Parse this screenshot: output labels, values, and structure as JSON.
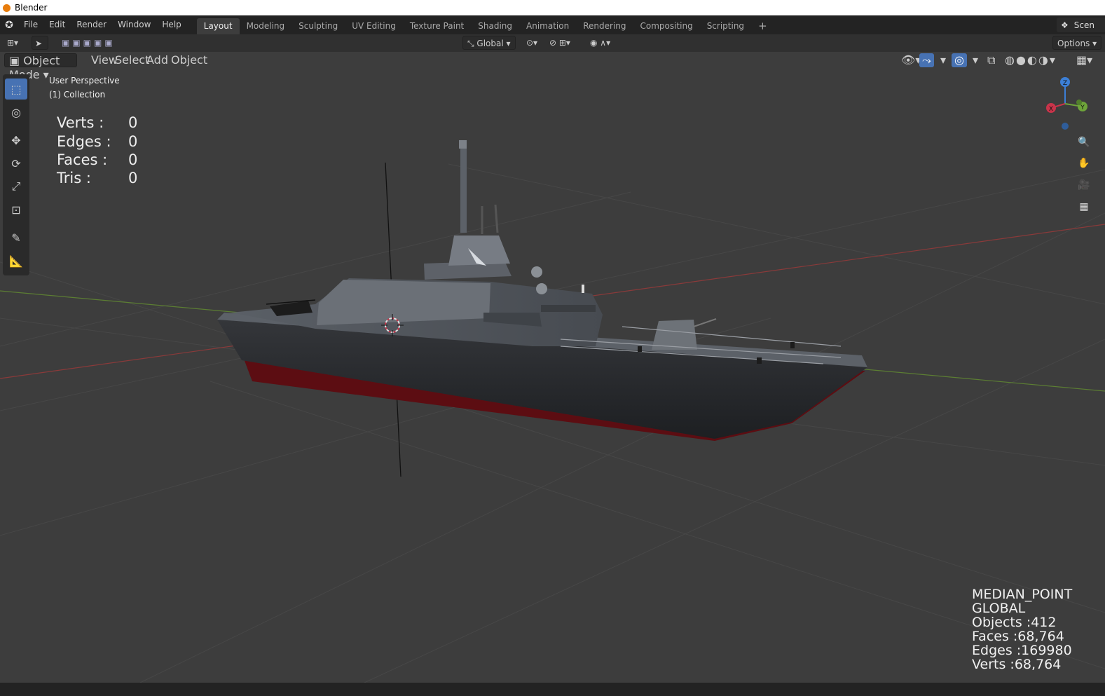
{
  "window": {
    "title": "Blender"
  },
  "menu": [
    "File",
    "Edit",
    "Render",
    "Window",
    "Help"
  ],
  "workspaces": [
    "Layout",
    "Modeling",
    "Sculpting",
    "UV Editing",
    "Texture Paint",
    "Shading",
    "Animation",
    "Rendering",
    "Compositing",
    "Scripting"
  ],
  "header": {
    "scene_label": "Scen",
    "orientation": "Global",
    "options_label": "Options"
  },
  "view_header": {
    "mode": "Object Mode",
    "view": "View",
    "select": "Select",
    "add": "Add",
    "object": "Object"
  },
  "overlay": {
    "perspective": "User Perspective",
    "collection": "(1) Collection"
  },
  "stats_left": [
    {
      "label": "Verts :",
      "value": "0"
    },
    {
      "label": "Edges :",
      "value": "0"
    },
    {
      "label": "Faces :",
      "value": "0"
    },
    {
      "label": "Tris :",
      "value": "0"
    }
  ],
  "stats_right": {
    "pivot": "MEDIAN_POINT",
    "orientation": "GLOBAL",
    "objects": "Objects :412",
    "faces": "Faces :68,764",
    "edges": "Edges :169980",
    "verts": "Verts :68,764"
  },
  "gizmo": {
    "x": "X",
    "y": "Y",
    "z": "Z"
  },
  "colors": {
    "accent": "#4772b3",
    "x_axis": "#c8344a",
    "y_axis": "#6ea53a",
    "z_axis": "#3c7fd6",
    "hull_bottom": "#6b0f14"
  }
}
